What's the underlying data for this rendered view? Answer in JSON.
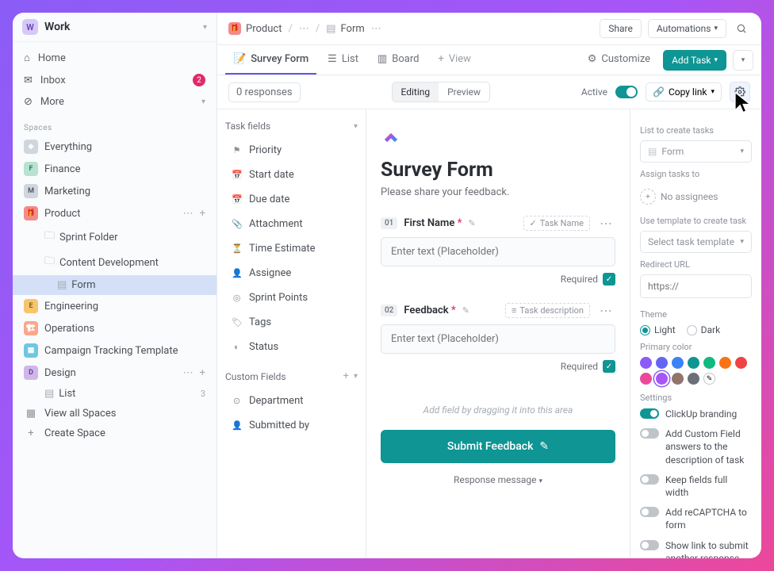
{
  "workspace": {
    "badge": "W",
    "name": "Work"
  },
  "nav": {
    "home": "Home",
    "inbox": "Inbox",
    "inbox_count": "2",
    "more": "More"
  },
  "spaces": {
    "header": "Spaces",
    "items": [
      {
        "label": "Everything",
        "icon": "◈",
        "color": "#cfd6de"
      },
      {
        "label": "Finance",
        "icon": "F",
        "color": "#b7e3d0"
      },
      {
        "label": "Marketing",
        "icon": "M",
        "color": "#cfd6de"
      },
      {
        "label": "Product",
        "icon": "🎁",
        "color": "#f28b8b"
      },
      {
        "label": "Engineering",
        "icon": "E",
        "color": "#f7c56b"
      },
      {
        "label": "Operations",
        "icon": "🏗",
        "color": "#f9a88b"
      },
      {
        "label": "Campaign Tracking Template",
        "icon": "▦",
        "color": "#6fc7e0"
      },
      {
        "label": "Design",
        "icon": "D",
        "color": "#d0b7ea"
      }
    ],
    "product_children": [
      {
        "label": "Sprint Folder"
      },
      {
        "label": "Content Development"
      },
      {
        "label": "Form"
      }
    ],
    "design_children": [
      {
        "label": "List",
        "count": "3"
      }
    ],
    "view_all": "View all Spaces",
    "create": "Create Space"
  },
  "breadcrumb": {
    "space": "Product",
    "list": "Form",
    "share": "Share",
    "automations": "Automations"
  },
  "views": {
    "survey_form": "Survey Form",
    "list": "List",
    "board": "Board",
    "add_view": "View",
    "customize": "Customize",
    "add_task": "Add Task"
  },
  "toolbar": {
    "responses": "0 responses",
    "editing": "Editing",
    "preview": "Preview",
    "active": "Active",
    "copy_link": "Copy link"
  },
  "task_fields": {
    "header": "Task fields",
    "items": [
      "Priority",
      "Start date",
      "Due date",
      "Attachment",
      "Time Estimate",
      "Assignee",
      "Sprint Points",
      "Tags",
      "Status"
    ],
    "custom_header": "Custom Fields",
    "custom": [
      "Department",
      "Submitted by"
    ]
  },
  "form": {
    "title": "Survey Form",
    "desc": "Please share your feedback.",
    "field1_num": "01",
    "field1_label": "First Name",
    "field1_tag": "Task Name",
    "placeholder": "Enter text (Placeholder)",
    "required": "Required",
    "field2_num": "02",
    "field2_label": "Feedback",
    "field2_tag": "Task description",
    "drop_hint": "Add field by dragging it into this area",
    "submit": "Submit Feedback",
    "resp_msg": "Response message"
  },
  "settings": {
    "list_label": "List to create tasks",
    "list_value": "Form",
    "assign_label": "Assign tasks to",
    "assign_value": "No assignees",
    "template_label": "Use template to create task",
    "template_value": "Select task template",
    "redirect_label": "Redirect URL",
    "redirect_placeholder": "https://",
    "theme_label": "Theme",
    "theme_light": "Light",
    "theme_dark": "Dark",
    "primary_label": "Primary color",
    "settings_header": "Settings",
    "opt1": "ClickUp branding",
    "opt2": "Add Custom Field answers to the description of task",
    "opt3": "Keep fields full width",
    "opt4": "Add reCAPTCHA to form",
    "opt5": "Show link to submit another response"
  },
  "colors": [
    "#8b5cf6",
    "#6366f1",
    "#3b82f6",
    "#0e9594",
    "#10b981",
    "#f97316",
    "#ef4444",
    "#ec4899",
    "#a855f7",
    "#92746b",
    "#6b7078"
  ]
}
